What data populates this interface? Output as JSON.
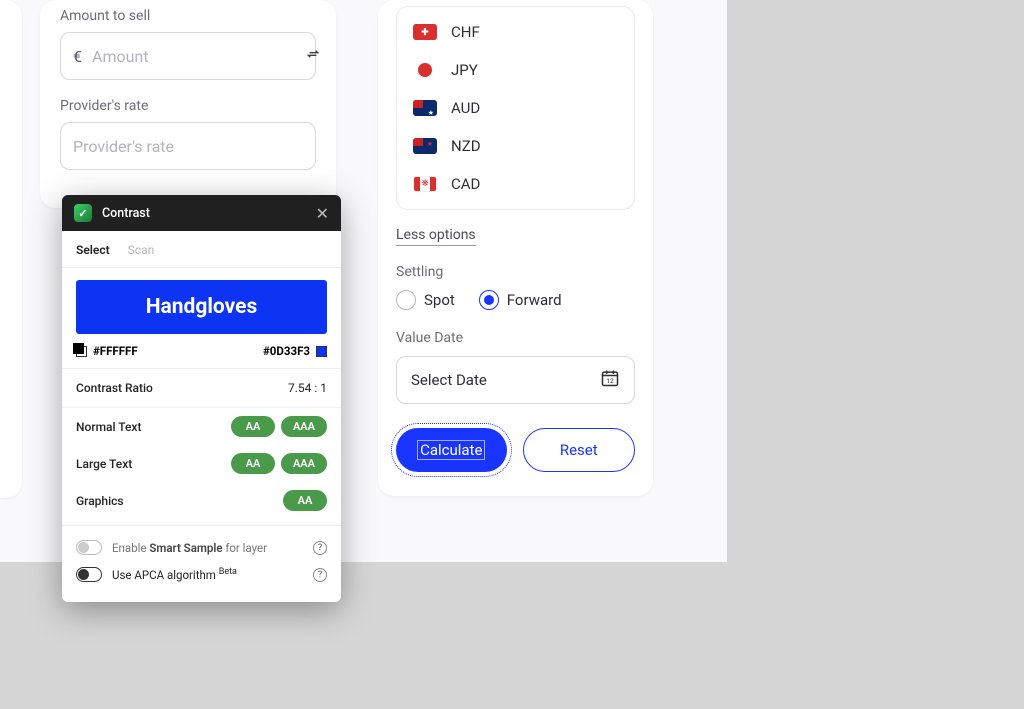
{
  "form": {
    "amount_label": "Amount to sell",
    "amount_currency": "€",
    "amount_placeholder": "Amount",
    "rate_label": "Provider's rate",
    "rate_placeholder": "Provider's rate"
  },
  "currencies": [
    {
      "code": "CHF",
      "flag": "flag-ch"
    },
    {
      "code": "JPY",
      "flag": "dot",
      "dot_color": "#d92f2f"
    },
    {
      "code": "AUD",
      "flag": "flag-au"
    },
    {
      "code": "NZD",
      "flag": "flag-nz"
    },
    {
      "code": "CAD",
      "flag": "flag-ca"
    }
  ],
  "less_options": "Less options",
  "settling": {
    "label": "Settling",
    "options": [
      "Spot",
      "Forward"
    ],
    "selected": "Forward"
  },
  "value_date": {
    "label": "Value Date",
    "placeholder": "Select Date"
  },
  "buttons": {
    "calculate": "Calculate",
    "reset": "Reset"
  },
  "plugin": {
    "title": "Contrast",
    "tabs": {
      "select": "Select",
      "scan": "Scan"
    },
    "sample_text": "Handgloves",
    "fg_hex": "#FFFFFF",
    "bg_hex": "#0D33F3",
    "ratio_label": "Contrast Ratio",
    "ratio_value": "7.54 : 1",
    "checks": {
      "normal": {
        "label": "Normal Text",
        "pills": [
          "AA",
          "AAA"
        ]
      },
      "large": {
        "label": "Large Text",
        "pills": [
          "AA",
          "AAA"
        ]
      },
      "graphics": {
        "label": "Graphics",
        "pills": [
          "AA"
        ]
      }
    },
    "options": {
      "smart_sample_prefix": "Enable ",
      "smart_sample_strong": "Smart Sample",
      "smart_sample_suffix": " for layer",
      "apca_prefix": "Use APCA algorithm ",
      "apca_super": "Beta"
    }
  }
}
